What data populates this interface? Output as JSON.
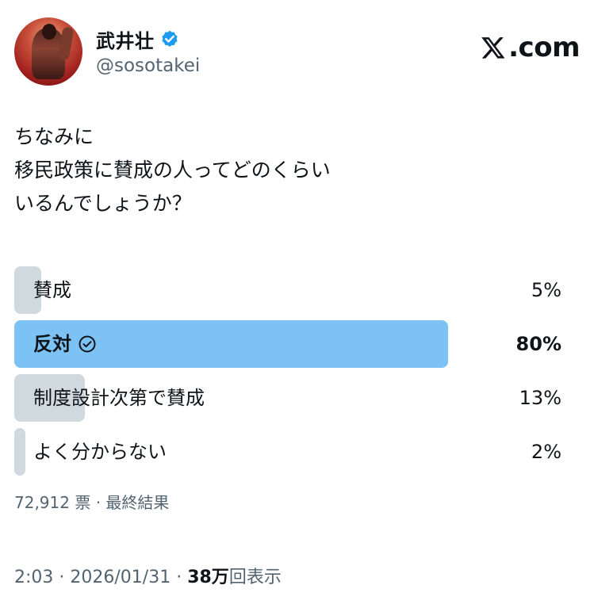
{
  "author": {
    "display_name": "武井壮",
    "handle": "@sosotakei",
    "verified": true
  },
  "brand": {
    "text": ".com",
    "logo": "x-logo-icon"
  },
  "tweet": {
    "text": "ちなみに\n移民政策に賛成の人ってどのくらい\nいるんでしょうか？"
  },
  "poll": {
    "options": [
      {
        "label": "賛成",
        "percent_text": "5%",
        "percent": 5,
        "winner": false
      },
      {
        "label": "反対",
        "percent_text": "80%",
        "percent": 80,
        "winner": true
      },
      {
        "label": "制度設計次第で賛成",
        "percent_text": "13%",
        "percent": 13,
        "winner": false
      },
      {
        "label": "よく分からない",
        "percent_text": "2%",
        "percent": 2,
        "winner": false
      }
    ],
    "votes": "72,912 票",
    "separator": " · ",
    "status": "最終結果"
  },
  "footer": {
    "time": "2:03",
    "date": "2026/01/31",
    "views_num": "38万",
    "views_label": "回表示",
    "separator": " · "
  },
  "colors": {
    "winner_bar": "#7cc2f4",
    "bar": "#cfd9de",
    "secondary_text": "#536471",
    "verified_badge": "#1d9bf0"
  }
}
